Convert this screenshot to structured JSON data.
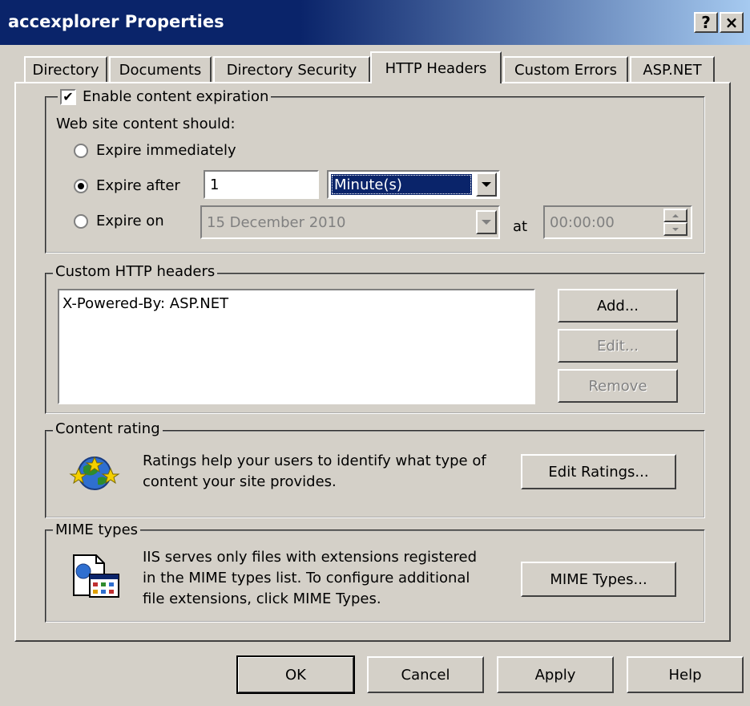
{
  "window": {
    "title": "accexplorer Properties",
    "help_btn": "?",
    "close_btn": "×"
  },
  "tabs": [
    "Directory",
    "Documents",
    "Directory Security",
    "HTTP Headers",
    "Custom Errors",
    "ASP.NET"
  ],
  "expiration": {
    "enable_label": "Enable content expiration",
    "enable_checked": true,
    "content_should": "Web site content should:",
    "opt_immediately": "Expire immediately",
    "opt_after": "Expire after",
    "opt_on": "Expire on",
    "selected": "after",
    "after_value": "1",
    "after_unit": "Minute(s)",
    "on_date": "15 December 2010",
    "at_label": "at",
    "at_time": "00:00:00"
  },
  "custom_headers": {
    "legend": "Custom HTTP headers",
    "items": [
      "X-Powered-By: ASP.NET"
    ],
    "add": "Add...",
    "edit": "Edit...",
    "remove": "Remove"
  },
  "content_rating": {
    "legend": "Content rating",
    "text1": "Ratings help your users to identify what type of",
    "text2": "content your site provides.",
    "button": "Edit Ratings..."
  },
  "mime": {
    "legend": "MIME types",
    "text1": "IIS serves only files with extensions registered",
    "text2": "in the MIME types list. To configure additional",
    "text3": "file extensions, click MIME Types.",
    "button": "MIME Types..."
  },
  "footer": {
    "ok": "OK",
    "cancel": "Cancel",
    "apply": "Apply",
    "help": "Help"
  }
}
